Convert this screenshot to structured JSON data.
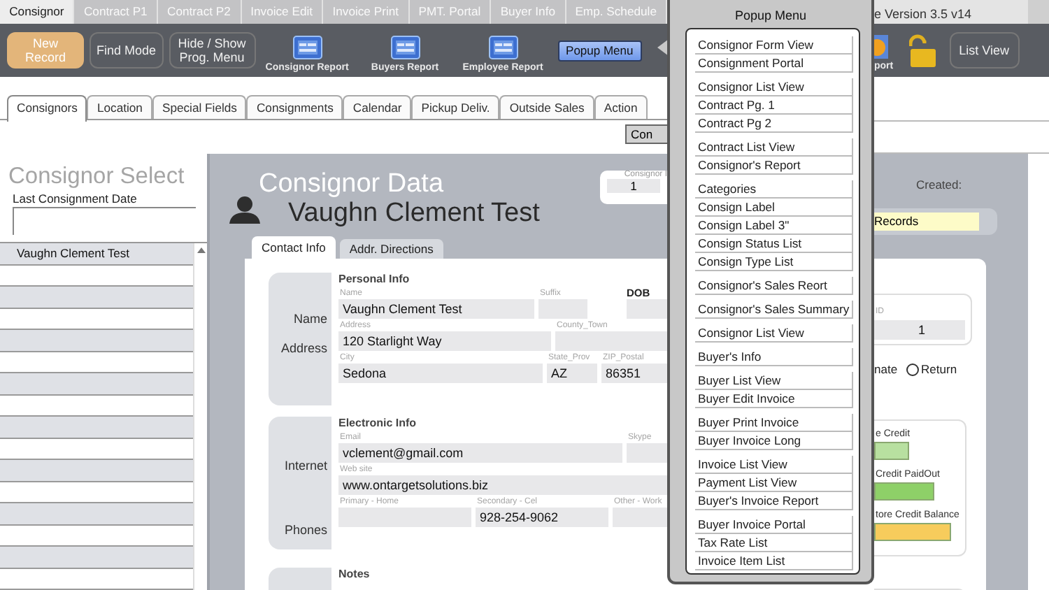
{
  "top_tabs": [
    {
      "label": "Consignor",
      "selected": true
    },
    {
      "label": "Contract P1",
      "selected": false
    },
    {
      "label": "Contract P2",
      "selected": false
    },
    {
      "label": "Invoice Edit",
      "selected": false
    },
    {
      "label": "Invoice Print",
      "selected": false
    },
    {
      "label": "PMT. Portal",
      "selected": false
    },
    {
      "label": "Buyer Info",
      "selected": false
    },
    {
      "label": "Emp. Schedule",
      "selected": false
    }
  ],
  "version_text": "e Version 3.5  v14",
  "toolbar": {
    "buttons": [
      {
        "label": "New Record",
        "kind": "primary"
      },
      {
        "label": "Find Mode",
        "kind": "plain"
      },
      {
        "label": "Hide / Show Prog. Menu",
        "kind": "plain"
      }
    ],
    "reports": [
      "Consignor Report",
      "Buyers Report",
      "Employee Report"
    ],
    "popup_button": "Popup Menu",
    "partial_report_label": "port",
    "locked": false,
    "list_view_button": "List View"
  },
  "sub_tabs": [
    {
      "label": "Consignors",
      "selected": true
    },
    {
      "label": "Location",
      "selected": false
    },
    {
      "label": "Special Fields",
      "selected": false
    },
    {
      "label": "Consignments",
      "selected": false
    },
    {
      "label": "Calendar",
      "selected": false
    },
    {
      "label": "Pickup Deliv.",
      "selected": false
    },
    {
      "label": "Outside Sales",
      "selected": false
    },
    {
      "label": "Action",
      "selected": false
    }
  ],
  "partial_button": "Con",
  "consignor_select": {
    "title": "Consignor Select",
    "date_label": "Last Consignment Date",
    "rows": [
      "Vaughn Clement Test"
    ]
  },
  "consignor_data": {
    "title": "Consignor Data",
    "name": "Vaughn Clement Test",
    "id_label": "Consignor I",
    "id_value": "1",
    "created_label": "Created:",
    "records_filter": "Records"
  },
  "detail_tabs": [
    {
      "label": "Contact Info",
      "selected": true
    },
    {
      "label": "Addr. Directions",
      "selected": false
    }
  ],
  "personal_info": {
    "title": "Personal Info",
    "side_labels": [
      "Name",
      "Address"
    ],
    "name_label": "Name",
    "name": "Vaughn Clement Test",
    "suffix_label": "Suffix",
    "dob_label": "DOB",
    "address_label": "Address",
    "address": "120 Starlight Way",
    "county_label": "County_Town",
    "city_label": "City",
    "city": "Sedona",
    "state_label": "State_Prov",
    "state": "AZ",
    "zip_label": "ZIP_Postal",
    "zip": "86351",
    "id_label": "ID",
    "id": "1",
    "partial_option": "nate",
    "return_option": {
      "label": "Return",
      "selected": false
    }
  },
  "electronic_info": {
    "title": "Electronic Info",
    "side_labels": [
      "Internet",
      "Phones"
    ],
    "email_label": "Email",
    "email": "vclement@gmail.com",
    "skype_label": "Skype",
    "web_label": "Web site",
    "web": "www.ontargetsolutions.biz",
    "phones": [
      {
        "label": "Primary - Home"
      },
      {
        "label": "Secondary - Cel",
        "value": "928-254-9062"
      },
      {
        "label": "Other - Work"
      }
    ]
  },
  "credits": [
    {
      "label": "e Credit",
      "color": "#b8e0a0"
    },
    {
      "label": "Credit PaidOut",
      "color": "#8ed068"
    },
    {
      "label": "tore Credit Balance",
      "color": "#f7cc5c"
    }
  ],
  "notes": {
    "title": "Notes"
  },
  "popup_menu": {
    "title": "Popup Menu",
    "groups": [
      [
        "Consignor Form View",
        "Consignment Portal"
      ],
      [
        "Consignor List View",
        "Contract Pg. 1",
        "Contract Pg 2"
      ],
      [
        "Contract List View",
        "Consignor's Report"
      ],
      [
        "Categories",
        "Consign Label",
        "Consign Label 3\"",
        "Consign Status List",
        "Consign Type List"
      ],
      [
        "Consignor's Sales Reort"
      ],
      [
        "Consignor's Sales Summary"
      ],
      [
        "Consignor List View"
      ],
      [
        "Buyer's Info"
      ],
      [
        "Buyer List View",
        "Buyer Edit Invoice"
      ],
      [
        "Buyer Print Invoice",
        "Buyer Invoice Long"
      ],
      [
        "Invoice List View",
        "Payment List View",
        "Buyer's Invoice Report"
      ],
      [
        "Buyer Invoice Portal",
        "Tax Rate List",
        "Invoice Item List"
      ]
    ]
  }
}
